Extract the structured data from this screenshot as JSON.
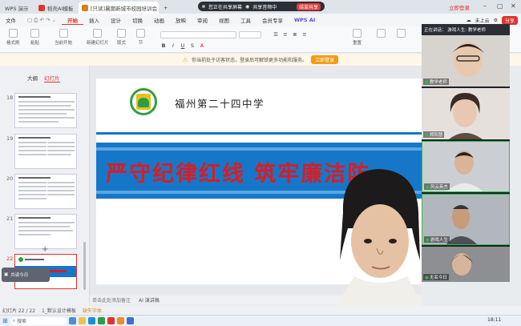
{
  "tabs": [
    {
      "label": "WPS 演示",
      "color": "#e0342f"
    },
    {
      "label": "稻壳AI模板",
      "color": "#e0342f"
    },
    {
      "label": "[只读]暑期新城市校园培训会",
      "color": "#e07b1a"
    }
  ],
  "screenshare": {
    "text": "您正在共享屏幕",
    "audio": "共享音频中",
    "end_label": "结束共享"
  },
  "login_label": "立即登录",
  "menu": {
    "file": "文件",
    "items": [
      "开始",
      "插入",
      "设计",
      "切换",
      "动画",
      "放映",
      "审阅",
      "视图",
      "工具",
      "会员专享"
    ],
    "active_index": 0,
    "wps_ai": "WPS AI",
    "unsynced": "未上云",
    "share": "分享"
  },
  "ribbon": {
    "groups": [
      "格式刷",
      "粘贴",
      "当前开始",
      "新建幻灯片",
      "版式",
      "节",
      "重置"
    ]
  },
  "notice": {
    "text": "你当前处于访客状态，登录后可解锁更多功能和服务。",
    "button": "立即登录"
  },
  "panel": {
    "tabs": [
      "大纲",
      "幻灯片"
    ],
    "active_tab": 1,
    "slide_numbers": [
      "18",
      "19",
      "20",
      "21",
      "22"
    ],
    "current": "22",
    "chat_label": "共读今日"
  },
  "slide": {
    "school": "福州第二十四中学",
    "slogan": "严守纪律红线  筑牢廉洁防"
  },
  "notes_placeholder": "单击此处添加备注",
  "ai_note": "AI 演讲稿",
  "video": {
    "header": "正在讲话：  游戏人生: 教学老师",
    "participants": [
      {
        "name": "教学老师"
      },
      {
        "name": "郑阳慧"
      },
      {
        "name": "风云英杰"
      },
      {
        "name": "游戏人生"
      },
      {
        "name": "无名今日"
      }
    ]
  },
  "status": {
    "slide_count": "幻灯片 22 / 22",
    "template": "1_默认设计模板",
    "missing_font": "缺失字体",
    "zoom": "Exe"
  },
  "taskbar": {
    "search": "搜索",
    "time": "18:11"
  },
  "colors": {
    "accent": "#e0342f",
    "banner_blue": "#1677c8",
    "slogan_red": "#d81d23",
    "logo_green": "#2e9e46"
  }
}
